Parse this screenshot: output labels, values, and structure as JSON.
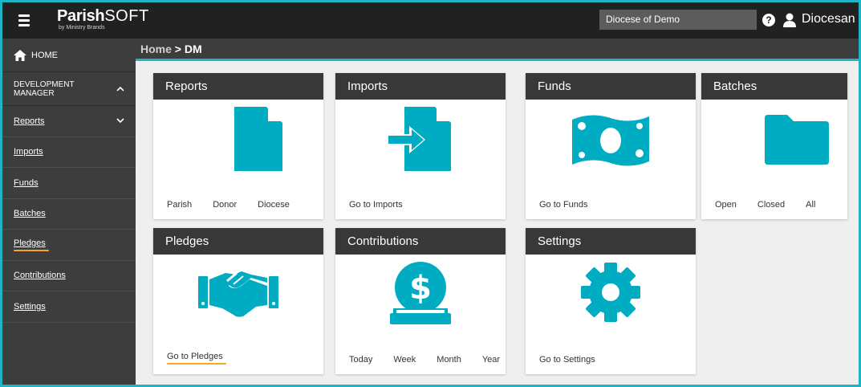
{
  "brand": {
    "name_bold": "Parish",
    "name_light": "SOFT",
    "tagline": "by Ministry Brands"
  },
  "header": {
    "org_select_value": "Diocese of Demo",
    "help_glyph": "?",
    "user_name": "Diocesan"
  },
  "breadcrumb": {
    "home": "Home",
    "separator": ">",
    "current": "DM"
  },
  "sidebar": {
    "home_label": "HOME",
    "section_label": "DEVELOPMENT MANAGER",
    "items": [
      {
        "label": "Reports"
      },
      {
        "label": "Imports"
      },
      {
        "label": "Funds"
      },
      {
        "label": "Batches"
      },
      {
        "label": "Pledges"
      },
      {
        "label": "Contributions"
      },
      {
        "label": "Settings"
      }
    ]
  },
  "cards": {
    "reports": {
      "title": "Reports",
      "links": [
        "Parish",
        "Donor",
        "Diocese"
      ]
    },
    "imports": {
      "title": "Imports",
      "links": [
        "Go to Imports"
      ]
    },
    "funds": {
      "title": "Funds",
      "links": [
        "Go to Funds"
      ]
    },
    "batches": {
      "title": "Batches",
      "links": [
        "Open",
        "Closed",
        "All"
      ]
    },
    "pledges": {
      "title": "Pledges",
      "links": [
        "Go to Pledges"
      ]
    },
    "contributions": {
      "title": "Contributions",
      "links": [
        "Today",
        "Week",
        "Month",
        "Year"
      ]
    },
    "settings": {
      "title": "Settings",
      "links": [
        "Go to Settings"
      ]
    }
  },
  "colors": {
    "accent": "#1fb3c6",
    "icon": "#00acc1",
    "highlight": "#f5a623",
    "header": "#383838"
  }
}
